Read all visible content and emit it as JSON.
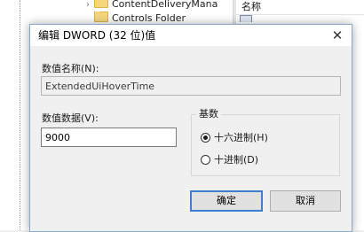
{
  "background": {
    "tree_items": [
      {
        "label": "ContentDeliveryMana"
      },
      {
        "label": "Controls Folder"
      }
    ],
    "list_header": "名称"
  },
  "dialog": {
    "title": "编辑 DWORD (32 位)值",
    "close_glyph": "✕",
    "name_label": "数值名称(N):",
    "name_value": "ExtendedUiHoverTime",
    "data_label": "数值数据(V):",
    "data_value": "9000",
    "base": {
      "label": "基数",
      "options": [
        {
          "label": "十六进制(H)",
          "selected": true
        },
        {
          "label": "十进制(D)",
          "selected": false
        }
      ]
    },
    "ok_label": "确定",
    "cancel_label": "取消"
  },
  "colors": {
    "default_button_border": "#3c7fd1",
    "window_border": "#8aa8c8"
  },
  "icons": [
    "folder-icon",
    "close-icon",
    "radio-icon",
    "registry-value-icon"
  ]
}
